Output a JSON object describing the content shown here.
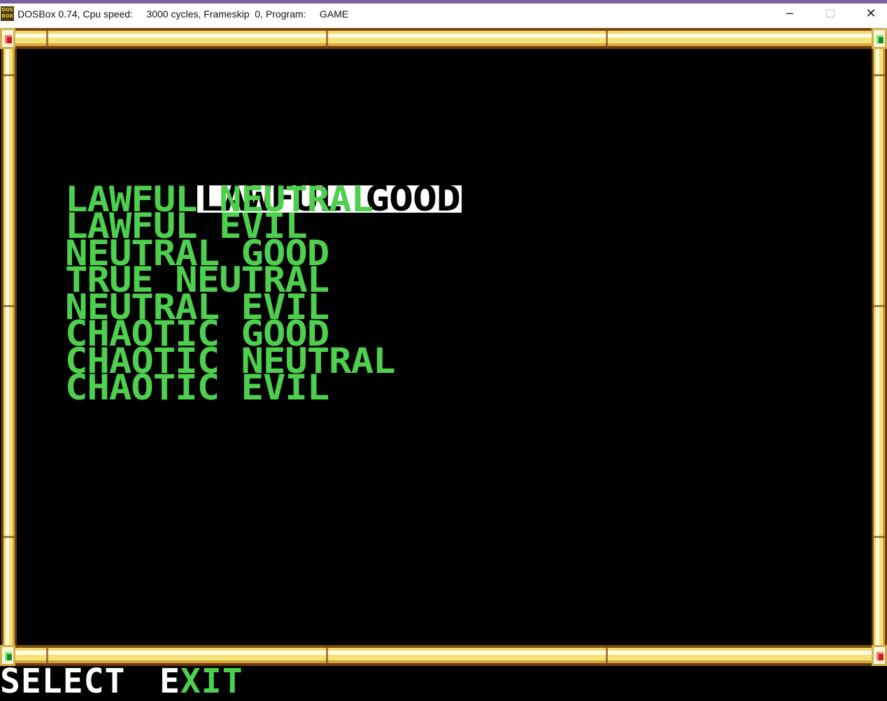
{
  "window": {
    "title": "DOSBox 0.74, Cpu speed:     3000 cycles, Frameskip  0, Program:     GAME",
    "icon": "dosbox-icon",
    "icon_text": "DOS BOX",
    "minimize_glyph": "─",
    "maximize_glyph": "☐",
    "close_glyph": "✕"
  },
  "colors": {
    "menu_text": "#4ed04e",
    "selected_bg": "#ffffff",
    "selected_text": "#000000",
    "frame_gold": "#f4e37a",
    "background": "#000000"
  },
  "menu": {
    "selected_index": 0,
    "items": [
      {
        "label": "LAWFUL GOOD"
      },
      {
        "label": "LAWFUL NEUTRAL"
      },
      {
        "label": "LAWFUL EVIL"
      },
      {
        "label": "NEUTRAL GOOD"
      },
      {
        "label": "TRUE NEUTRAL"
      },
      {
        "label": "NEUTRAL EVIL"
      },
      {
        "label": "CHAOTIC GOOD"
      },
      {
        "label": "CHAOTIC NEUTRAL"
      },
      {
        "label": "CHAOTIC EVIL"
      }
    ]
  },
  "commands": {
    "select": "SELECT",
    "exit_hotkey": "E",
    "exit_rest": "XIT"
  }
}
